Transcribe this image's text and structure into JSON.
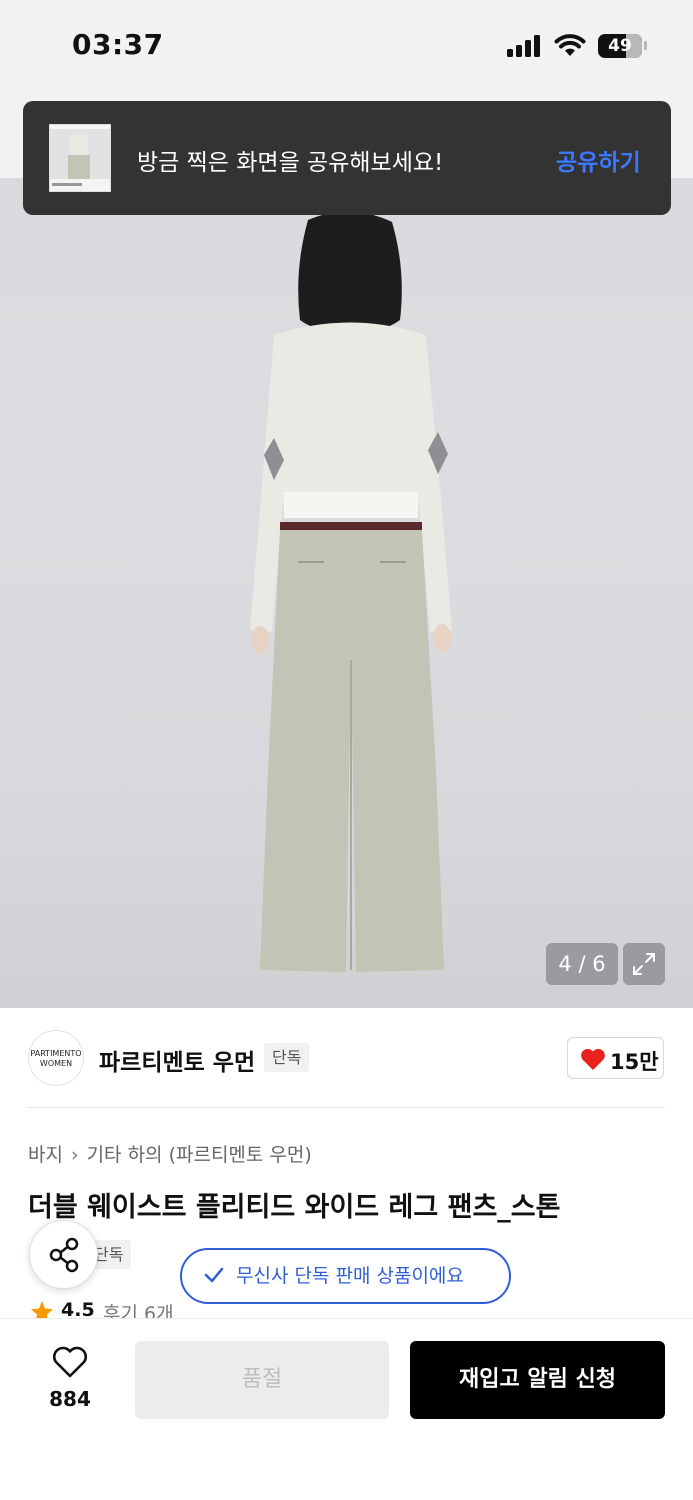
{
  "status_bar": {
    "time": "03:37",
    "battery": "49"
  },
  "toast": {
    "message": "방금 찍은 화면을 공유해보세요!",
    "action_label": "공유하기"
  },
  "gallery": {
    "counter": "4 / 6"
  },
  "brand": {
    "logo_text_line1": "PARTIMENTO",
    "logo_text_line2": "WOMEN",
    "name": "파르티멘토 우먼",
    "tag": "단독",
    "like_count": "15만"
  },
  "product": {
    "breadcrumb": [
      "바지",
      "기타 하의 (파르티멘토 우먼)"
    ],
    "title": "더블 웨이스트 플리티드 와이드 레그 팬츠_스톤",
    "exclusive_tag": "단독",
    "rating": "4.5",
    "reviews": "후기 6개"
  },
  "notice": {
    "text": "무신사 단독 판매 상품이에요"
  },
  "bottom_bar": {
    "wish_count": "884",
    "soldout_label": "품절",
    "restock_label": "재입고 알림 신청"
  },
  "colors": {
    "accent_blue": "#2f5fd8",
    "toast_bg": "#333333",
    "like_red": "#e8231f",
    "star_orange": "#f59a00"
  },
  "icons": [
    "signal-icon",
    "wifi-icon",
    "battery-icon",
    "expand-icon",
    "heart-filled-icon",
    "share-icon",
    "check-icon",
    "star-icon",
    "heart-outline-icon"
  ]
}
